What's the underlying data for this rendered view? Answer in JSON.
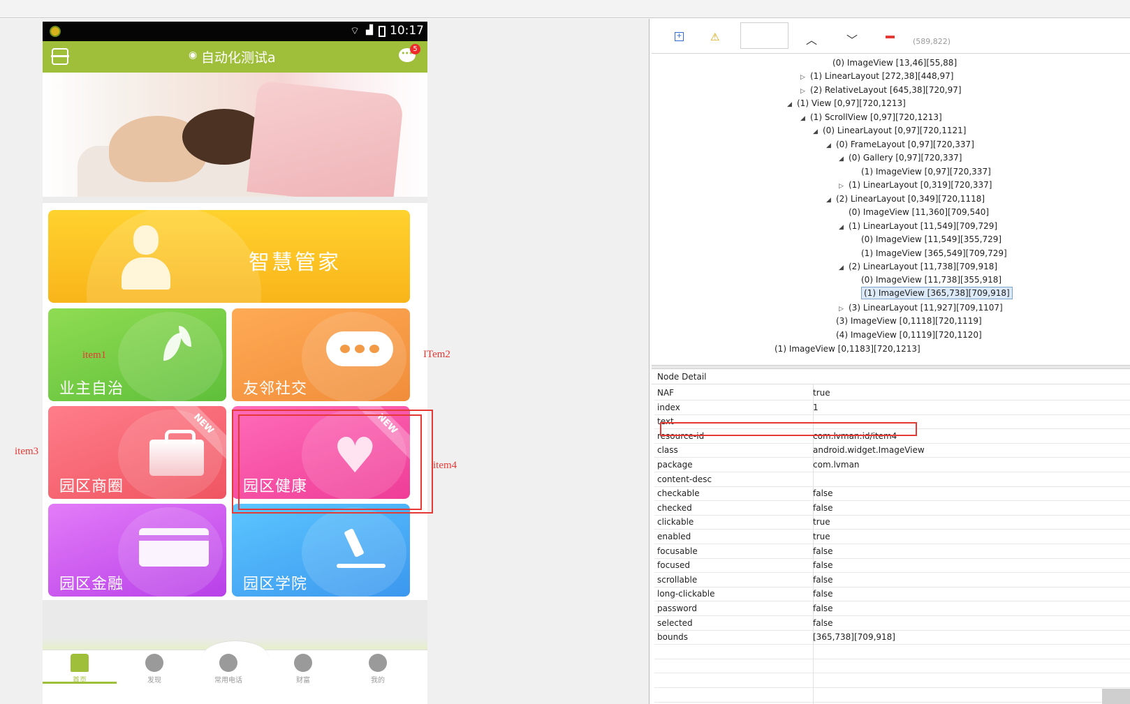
{
  "phone": {
    "status": {
      "time": "10:17"
    },
    "appbar": {
      "title": "自动化测试a",
      "badge": "5"
    },
    "tiles": [
      {
        "label": "智慧管家"
      },
      {
        "label": "业主自治"
      },
      {
        "label": "友邻社交"
      },
      {
        "label": "园区商圈",
        "ribbon": "NEW"
      },
      {
        "label": "园区健康",
        "ribbon": "NEW"
      },
      {
        "label": "园区金融"
      },
      {
        "label": "园区学院"
      }
    ],
    "nav": [
      {
        "label": "首页"
      },
      {
        "label": "发现"
      },
      {
        "label": "常用电话"
      },
      {
        "label": "财富"
      },
      {
        "label": "我的"
      }
    ]
  },
  "annotations": {
    "item1": "item1",
    "item2": "ITem2",
    "item3": "item3",
    "item4": "item4"
  },
  "viewer": {
    "coords": "(589,822)",
    "tree": [
      "(0) ImageView [13,46][55,88]",
      "(1) LinearLayout [272,38][448,97]",
      "(2) RelativeLayout [645,38][720,97]",
      "(1) View [0,97][720,1213]",
      "(1) ScrollView [0,97][720,1213]",
      "(0) LinearLayout [0,97][720,1121]",
      "(0) FrameLayout [0,97][720,337]",
      "(0) Gallery [0,97][720,337]",
      "(1) ImageView [0,97][720,337]",
      "(1) LinearLayout [0,319][720,337]",
      "(2) LinearLayout [0,349][720,1118]",
      "(0) ImageView [11,360][709,540]",
      "(1) LinearLayout [11,549][709,729]",
      "(0) ImageView [11,549][355,729]",
      "(1) ImageView [365,549][709,729]",
      "(2) LinearLayout [11,738][709,918]",
      "(0) ImageView [11,738][355,918]",
      "(1) ImageView [365,738][709,918]",
      "(3) LinearLayout [11,927][709,1107]",
      "(3) ImageView [0,1118][720,1119]",
      "(4) ImageView [0,1119][720,1120]",
      "(1) ImageView [0,1183][720,1213]"
    ],
    "detail_title": "Node Detail",
    "detail": [
      {
        "k": "NAF",
        "v": "true"
      },
      {
        "k": "index",
        "v": "1"
      },
      {
        "k": "text",
        "v": ""
      },
      {
        "k": "resource-id",
        "v": "com.lvman:id/item4"
      },
      {
        "k": "class",
        "v": "android.widget.ImageView"
      },
      {
        "k": "package",
        "v": "com.lvman"
      },
      {
        "k": "content-desc",
        "v": ""
      },
      {
        "k": "checkable",
        "v": "false"
      },
      {
        "k": "checked",
        "v": "false"
      },
      {
        "k": "clickable",
        "v": "true"
      },
      {
        "k": "enabled",
        "v": "true"
      },
      {
        "k": "focusable",
        "v": "false"
      },
      {
        "k": "focused",
        "v": "false"
      },
      {
        "k": "scrollable",
        "v": "false"
      },
      {
        "k": "long-clickable",
        "v": "false"
      },
      {
        "k": "password",
        "v": "false"
      },
      {
        "k": "selected",
        "v": "false"
      },
      {
        "k": "bounds",
        "v": "[365,738][709,918]"
      }
    ]
  }
}
